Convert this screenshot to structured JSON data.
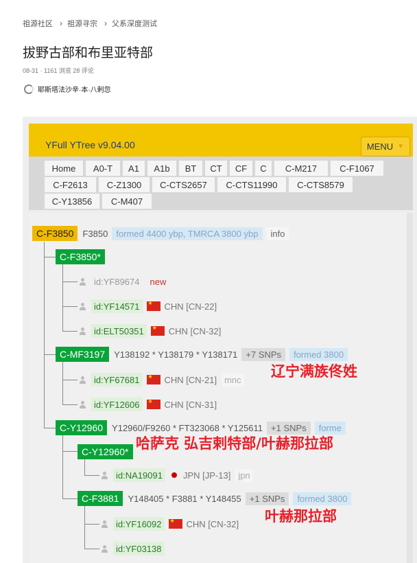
{
  "breadcrumb": {
    "items": [
      "祖源社区",
      "祖源寻宗",
      "父系深度测试"
    ]
  },
  "article": {
    "title": "拔野古部和布里亚特部",
    "meta": "08-31 · 1161 浏览 28 评论",
    "author": "耶斯塔法沙辛·本·八剌忽"
  },
  "yfull": {
    "title": "YFull YTree v9.04.00",
    "menu_label": "MENU",
    "nav_tabs": [
      "Home",
      "A0-T",
      "A1",
      "A1b",
      "BT",
      "CT",
      "CF",
      "C",
      "C-M217",
      "C-F1067",
      "C-F2613",
      "C-Z1300",
      "C-CTS2657",
      "C-CTS11990",
      "C-CTS8579",
      "C-Y13856",
      "C-M407"
    ]
  },
  "tree": {
    "root": {
      "label": "C-F3850",
      "snps": "F3850",
      "formed": "formed 4400 ybp, TMRCA 3800 ybp",
      "info": "info"
    },
    "n1": {
      "label": "C-F3850*"
    },
    "s1": {
      "id": "id:YF89674",
      "tag": "new"
    },
    "s2": {
      "id": "id:YF14571",
      "country": "CHN [CN-22]"
    },
    "s3": {
      "id": "id:ELT50351",
      "country": "CHN [CN-32]"
    },
    "n2": {
      "label": "C-MF3197",
      "snps": "Y138192 * Y138179 * Y138171",
      "extra": "+7 SNPs",
      "formed": "formed 3800"
    },
    "s4": {
      "id": "id:YF67681",
      "country": "CHN [CN-21]",
      "tag": "mnc"
    },
    "s5": {
      "id": "id:YF12606",
      "country": "CHN [CN-31]"
    },
    "n3": {
      "label": "C-Y12960",
      "snps": "Y12960/F9260 * FT323068 * Y125611",
      "extra": "+1 SNPs",
      "formed": "forme"
    },
    "n4": {
      "label": "C-Y12960*"
    },
    "s6": {
      "id": "id:NA19091",
      "country": "JPN [JP-13]",
      "tag": "jpn"
    },
    "n5": {
      "label": "C-F3881",
      "snps": "Y148405 * F3881 * Y148455",
      "extra": "+1 SNPs",
      "formed": "formed 3800"
    },
    "s7": {
      "id": "id:YF16092",
      "country": "CHN [CN-32]"
    },
    "s8": {
      "id": "id:YF03138"
    }
  },
  "annotations": {
    "a1": "辽宁满族佟姓",
    "a2": "哈萨克 弘吉剌特部/叶赫那拉部",
    "a3": "叶赫那拉部"
  },
  "colors": {
    "header_yellow": "#f3c500",
    "node_green": "#0aa33a",
    "annotation_red": "#e8202a"
  }
}
